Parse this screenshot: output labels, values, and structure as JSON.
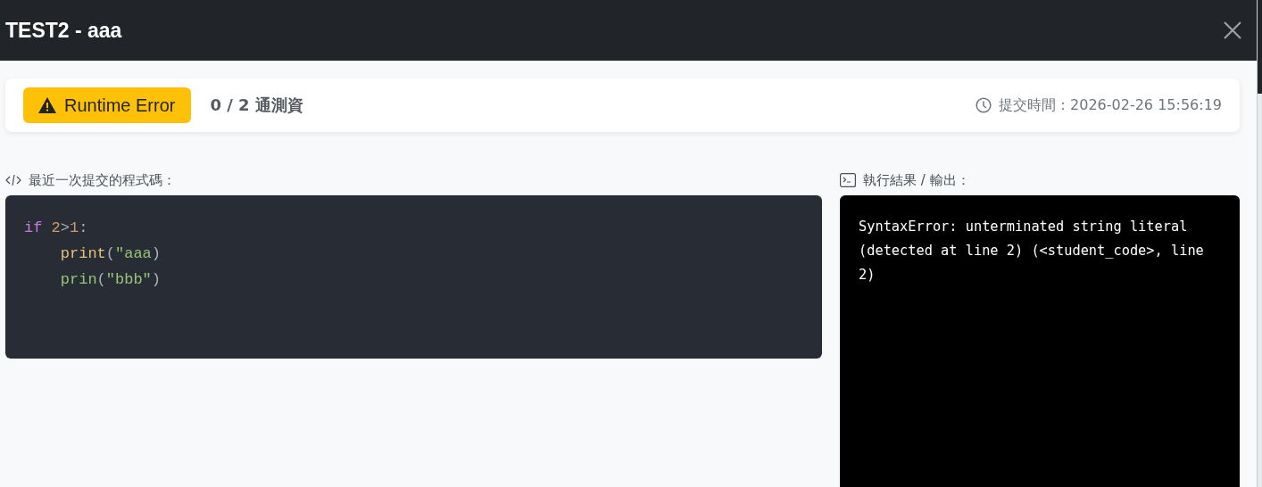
{
  "window": {
    "title": "TEST2 - aaa"
  },
  "status": {
    "verdict": {
      "kind": "warning",
      "label": "Runtime Error"
    },
    "passed": "0 / 2 通測資",
    "submitted_at": "提交時間：2026-02-26 15:56:19"
  },
  "code_panel": {
    "label": "最近一次提交的程式碼：",
    "lines": [
      {
        "indented": false,
        "tokens": [
          {
            "kind": "keyword",
            "text": "if"
          },
          {
            "kind": "number",
            "text": " 2"
          },
          {
            "kind": "plain",
            "text": ">"
          },
          {
            "kind": "number",
            "text": "1"
          },
          {
            "kind": "plain",
            "text": ":"
          }
        ]
      },
      {
        "indented": true,
        "tokens": [
          {
            "kind": "function",
            "text": "print"
          },
          {
            "kind": "plain",
            "text": "("
          },
          {
            "kind": "string",
            "text": "\"aaa"
          },
          {
            "kind": "plain",
            "text": ")"
          }
        ]
      },
      {
        "indented": true,
        "tokens": [
          {
            "kind": "string",
            "text": "prin"
          },
          {
            "kind": "plain",
            "text": "("
          },
          {
            "kind": "string",
            "text": "\"bbb\""
          },
          {
            "kind": "plain",
            "text": ")"
          }
        ]
      }
    ]
  },
  "output_panel": {
    "label": "執行結果 / 輸出：",
    "text": "SyntaxError: unterminated string literal (detected at line 2) (<student_code>, line 2)"
  }
}
